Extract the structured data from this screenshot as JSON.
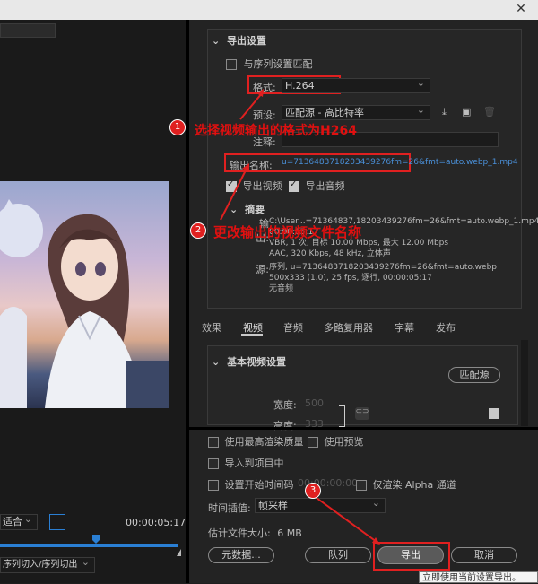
{
  "window": {
    "close_glyph": "✕"
  },
  "export_settings": {
    "section_title": "导出设置",
    "match_sequence_label": "与序列设置匹配",
    "format_label": "格式:",
    "format_value": "H.264",
    "preset_label": "预设:",
    "preset_value": "匹配源 - 高比特率",
    "comments_label": "注释:",
    "output_name_label": "输出名称:",
    "output_name_value": "u=7136483718203439276fm=26&fmt=auto.webp_1.mp4",
    "export_video_label": "导出视频",
    "export_audio_label": "导出音频"
  },
  "summary": {
    "title": "摘要",
    "output_label": "输出:",
    "output_lines": [
      "C:\\User...=71364837,18203439276fm=26&fmt=auto.webp_1.mp4",
      "VBR, 1 次, 目标 10.00 Mbps, 最大 12.00 Mbps",
      "AAC, 320 Kbps, 48  kHz, 立体声"
    ],
    "source_label": "源:",
    "source_lines": [
      "序列, u=7136483718203439276fm=26&fmt=auto.webp",
      "500x333 (1.0), 25 fps, 逐行, 00:00:05:17",
      "无音频"
    ],
    "output_line2_partial": "00:00:05:17"
  },
  "tabs": [
    "效果",
    "视频",
    "音频",
    "多路复用器",
    "字幕",
    "发布"
  ],
  "video_settings": {
    "section_title": "基本视频设置",
    "match_source_button": "匹配源",
    "width_label": "宽度:",
    "width_value": "500",
    "height_label": "高度:",
    "height_value": "333"
  },
  "bottom_options": {
    "max_render_quality": "使用最高渲染质量",
    "use_previews": "使用预览",
    "import_into_project": "导入到项目中",
    "set_start_timecode": "设置开始时间码",
    "start_timecode_value": "00:00:00:00",
    "render_alpha_only": "仅渲染 Alpha 通道",
    "time_interpolation_label": "时间插值:",
    "time_interpolation_value": "帧采样",
    "estimated_size_label": "估计文件大小:",
    "estimated_size_value": "6 MB"
  },
  "buttons": {
    "metadata": "元数据...",
    "queue": "队列",
    "export": "导出",
    "cancel": "取消"
  },
  "tooltip": "立即使用当前设置导出。",
  "left_panel": {
    "fit_dropdown": "适合",
    "timecode": "00:00:05:17",
    "source_range": "序列切入/序列切出"
  },
  "annotations": {
    "badge1": "1",
    "text1": "选择视频输出的格式为H264",
    "badge2": "2",
    "text2": "更改输出的视频文件名称",
    "badge3": "3"
  },
  "colors": {
    "accent_red": "#e02020",
    "link_blue": "#4a90d9",
    "timeline_blue": "#2a7fd4"
  }
}
